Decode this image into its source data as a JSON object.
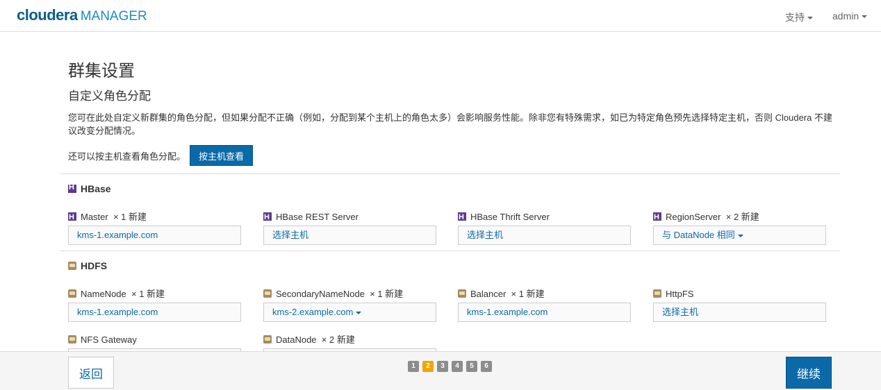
{
  "header": {
    "brand": "cloudera",
    "product": "MANAGER",
    "support_label": "支持",
    "user_label": "admin"
  },
  "page": {
    "title": "群集设置",
    "subtitle": "自定义角色分配",
    "description": "您可在此处自定义新群集的角色分配，但如果分配不正确（例如，分配到某个主机上的角色太多）会影响服务性能。除非您有特殊需求，如已为特定角色预先选择特定主机，否则 Cloudera 不建议改变分配情况。",
    "hint": "还可以按主机查看角色分配。",
    "host_view_button": "按主机查看"
  },
  "hbase": {
    "name": "HBase",
    "roles": [
      {
        "label": "Master",
        "count": "×  1 新建",
        "value": "kms-1.example.com"
      },
      {
        "label": "HBase REST Server",
        "count": "",
        "value": "选择主机"
      },
      {
        "label": "HBase Thrift Server",
        "count": "",
        "value": "选择主机"
      },
      {
        "label": "RegionServer",
        "count": "×  2 新建",
        "value": "与 DataNode 相同"
      }
    ]
  },
  "hdfs": {
    "name": "HDFS",
    "roles": [
      {
        "label": "NameNode",
        "count": "×  1 新建",
        "value": "kms-1.example.com"
      },
      {
        "label": "SecondaryNameNode",
        "count": "×  1 新建",
        "value": "kms-2.example.com"
      },
      {
        "label": "Balancer",
        "count": "×  1 新建",
        "value": "kms-1.example.com"
      },
      {
        "label": "HttpFS",
        "count": "",
        "value": "选择主机"
      },
      {
        "label": "NFS Gateway",
        "count": "",
        "value": ""
      },
      {
        "label": "DataNode",
        "count": "×  2 新建",
        "value": ""
      }
    ]
  },
  "footer": {
    "back_label": "返回",
    "next_label": "继续",
    "pages": [
      "1",
      "2",
      "3",
      "4",
      "5",
      "6"
    ],
    "current_page": "2"
  },
  "colors": {
    "accent": "#0a6aa8",
    "pager_active": "#f0a500",
    "pager_inactive": "#8c8c8c",
    "hbase_icon": "#5b3a8e",
    "hdfs_icon": "#a88a5c"
  }
}
